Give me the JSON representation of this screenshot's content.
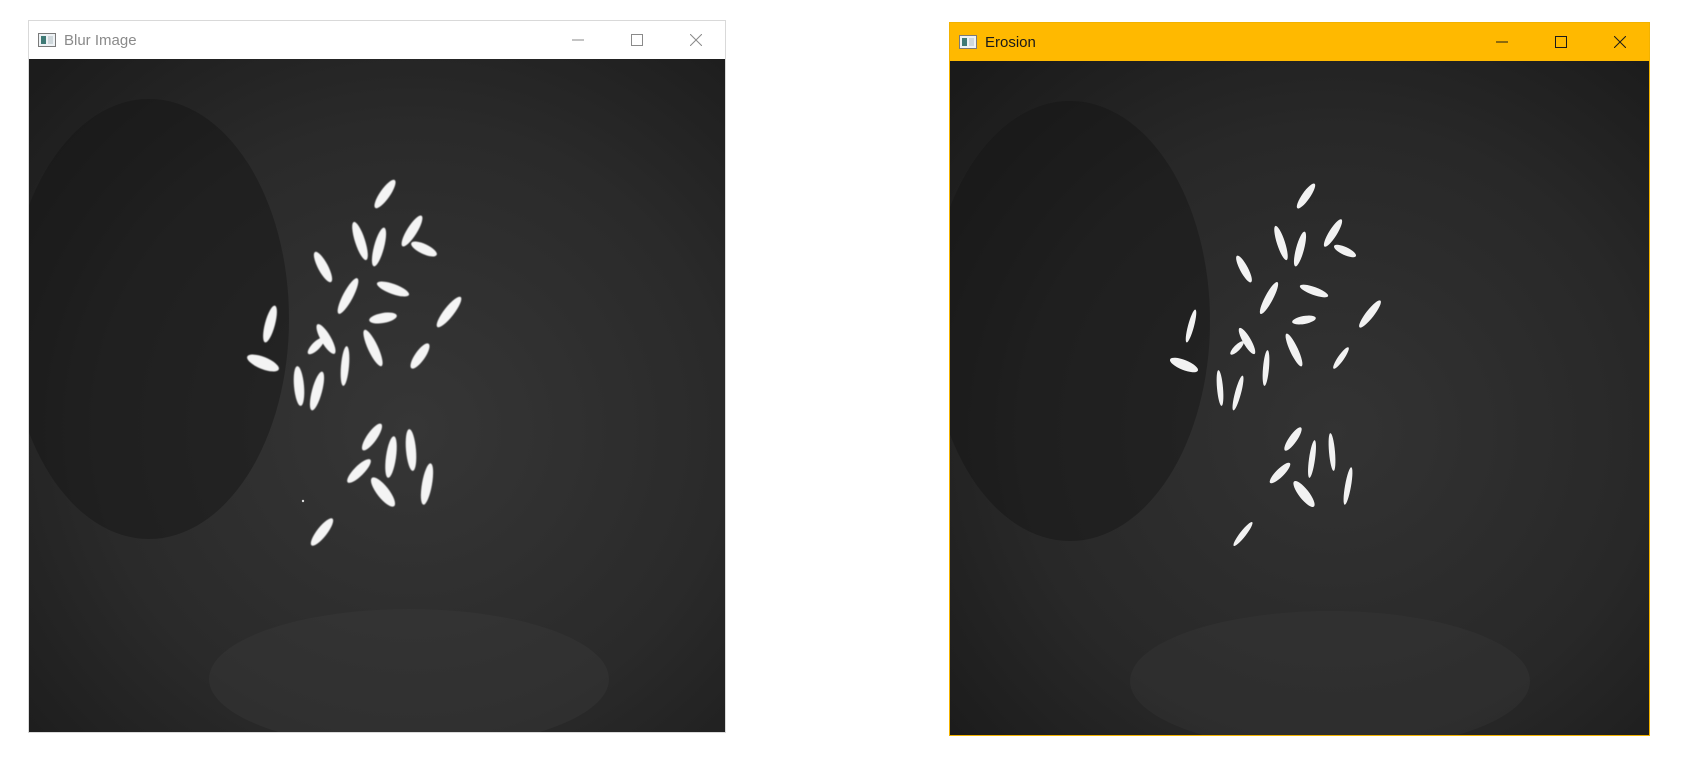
{
  "windows": [
    {
      "title": "Blur Image",
      "state": "inactive",
      "controls": [
        "minimize-icon",
        "maximize-icon",
        "close-icon"
      ]
    },
    {
      "title": "Erosion",
      "state": "active",
      "accent_color": "#FFB900",
      "controls": [
        "minimize-icon",
        "maximize-icon",
        "close-icon"
      ]
    }
  ],
  "image": {
    "description_color_background": "#2a2a2a",
    "grain_color": "#f2f2f2"
  }
}
